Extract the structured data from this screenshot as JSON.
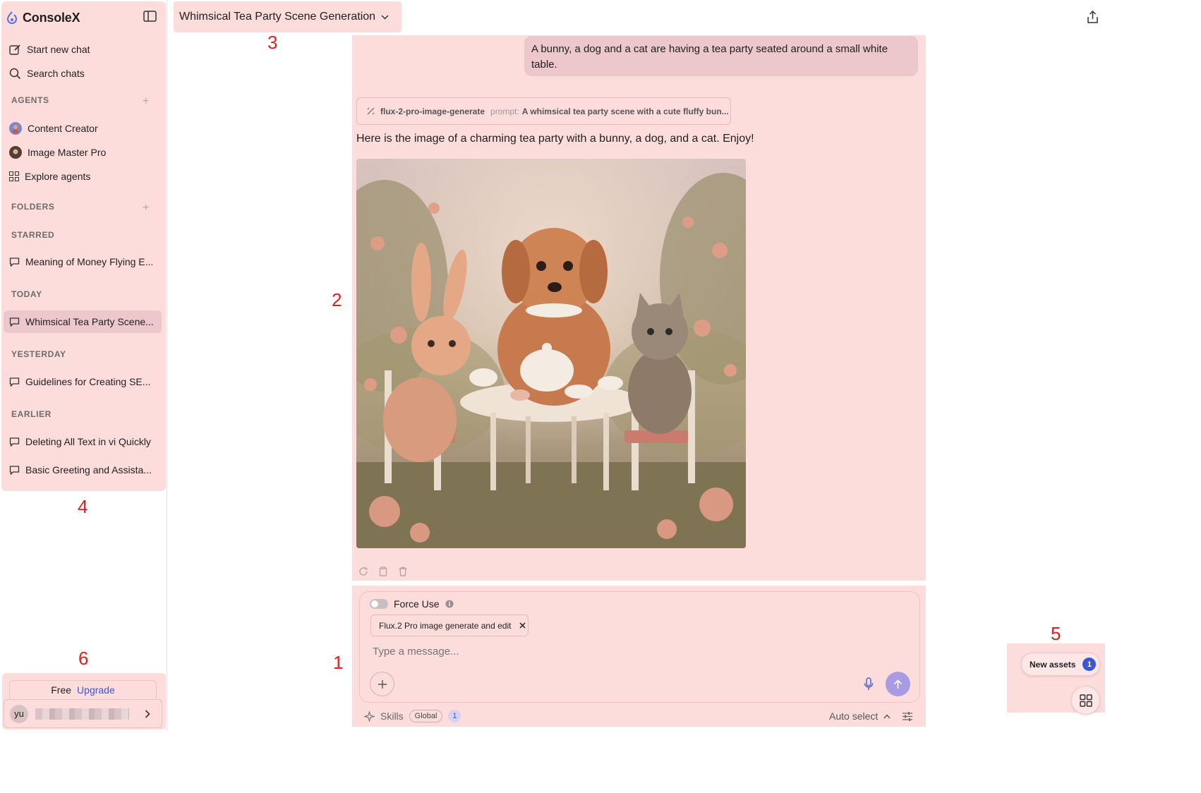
{
  "app": {
    "name": "ConsoleX"
  },
  "sidebar": {
    "start_new_chat": "Start new chat",
    "search_chats": "Search chats",
    "agents_label": "AGENTS",
    "agents": [
      {
        "label": "Content Creator",
        "icon": "avatar-content-creator"
      },
      {
        "label": "Image Master Pro",
        "icon": "avatar-image-master"
      },
      {
        "label": "Explore agents",
        "icon": "grid-icon"
      }
    ],
    "folders_label": "FOLDERS",
    "starred_label": "STARRED",
    "starred": [
      "Meaning of Money Flying E..."
    ],
    "today_label": "TODAY",
    "today": [
      "Whimsical Tea Party Scene..."
    ],
    "yesterday_label": "YESTERDAY",
    "yesterday": [
      "Guidelines for Creating SE..."
    ],
    "earlier_label": "EARLIER",
    "earlier": [
      "Deleting All Text in vi Quickly",
      "Basic Greeting and Assista..."
    ],
    "plan": {
      "tier": "Free",
      "upgrade": "Upgrade"
    },
    "user": {
      "initials": "yu"
    }
  },
  "header": {
    "title": "Whimsical Tea Party Scene Generation"
  },
  "chat": {
    "user_message": "A bunny, a dog and a cat are having a tea party seated around a small white table.",
    "tool_call": {
      "name": "flux-2-pro-image-generate",
      "prompt_label": "prompt:",
      "prompt": "A whimsical tea party scene with a cute fluffy bun..."
    },
    "assistant_message": "Here is the image of a charming tea party with a bunny, a dog, and a cat. Enjoy!"
  },
  "composer": {
    "force_use": "Force Use",
    "tool_chip": "Flux.2 Pro image generate and edit",
    "placeholder": "Type a message...",
    "skills": "Skills",
    "global": "Global",
    "skills_count": "1",
    "model_select": "Auto select"
  },
  "assets": {
    "label": "New assets",
    "count": "1"
  },
  "annotations": [
    "1",
    "2",
    "3",
    "4",
    "5",
    "6"
  ],
  "colors": {
    "highlight": "#fddcdc",
    "active": "#ecc7cc",
    "accent": "#3b55d9",
    "annotation": "#e61e1e"
  }
}
